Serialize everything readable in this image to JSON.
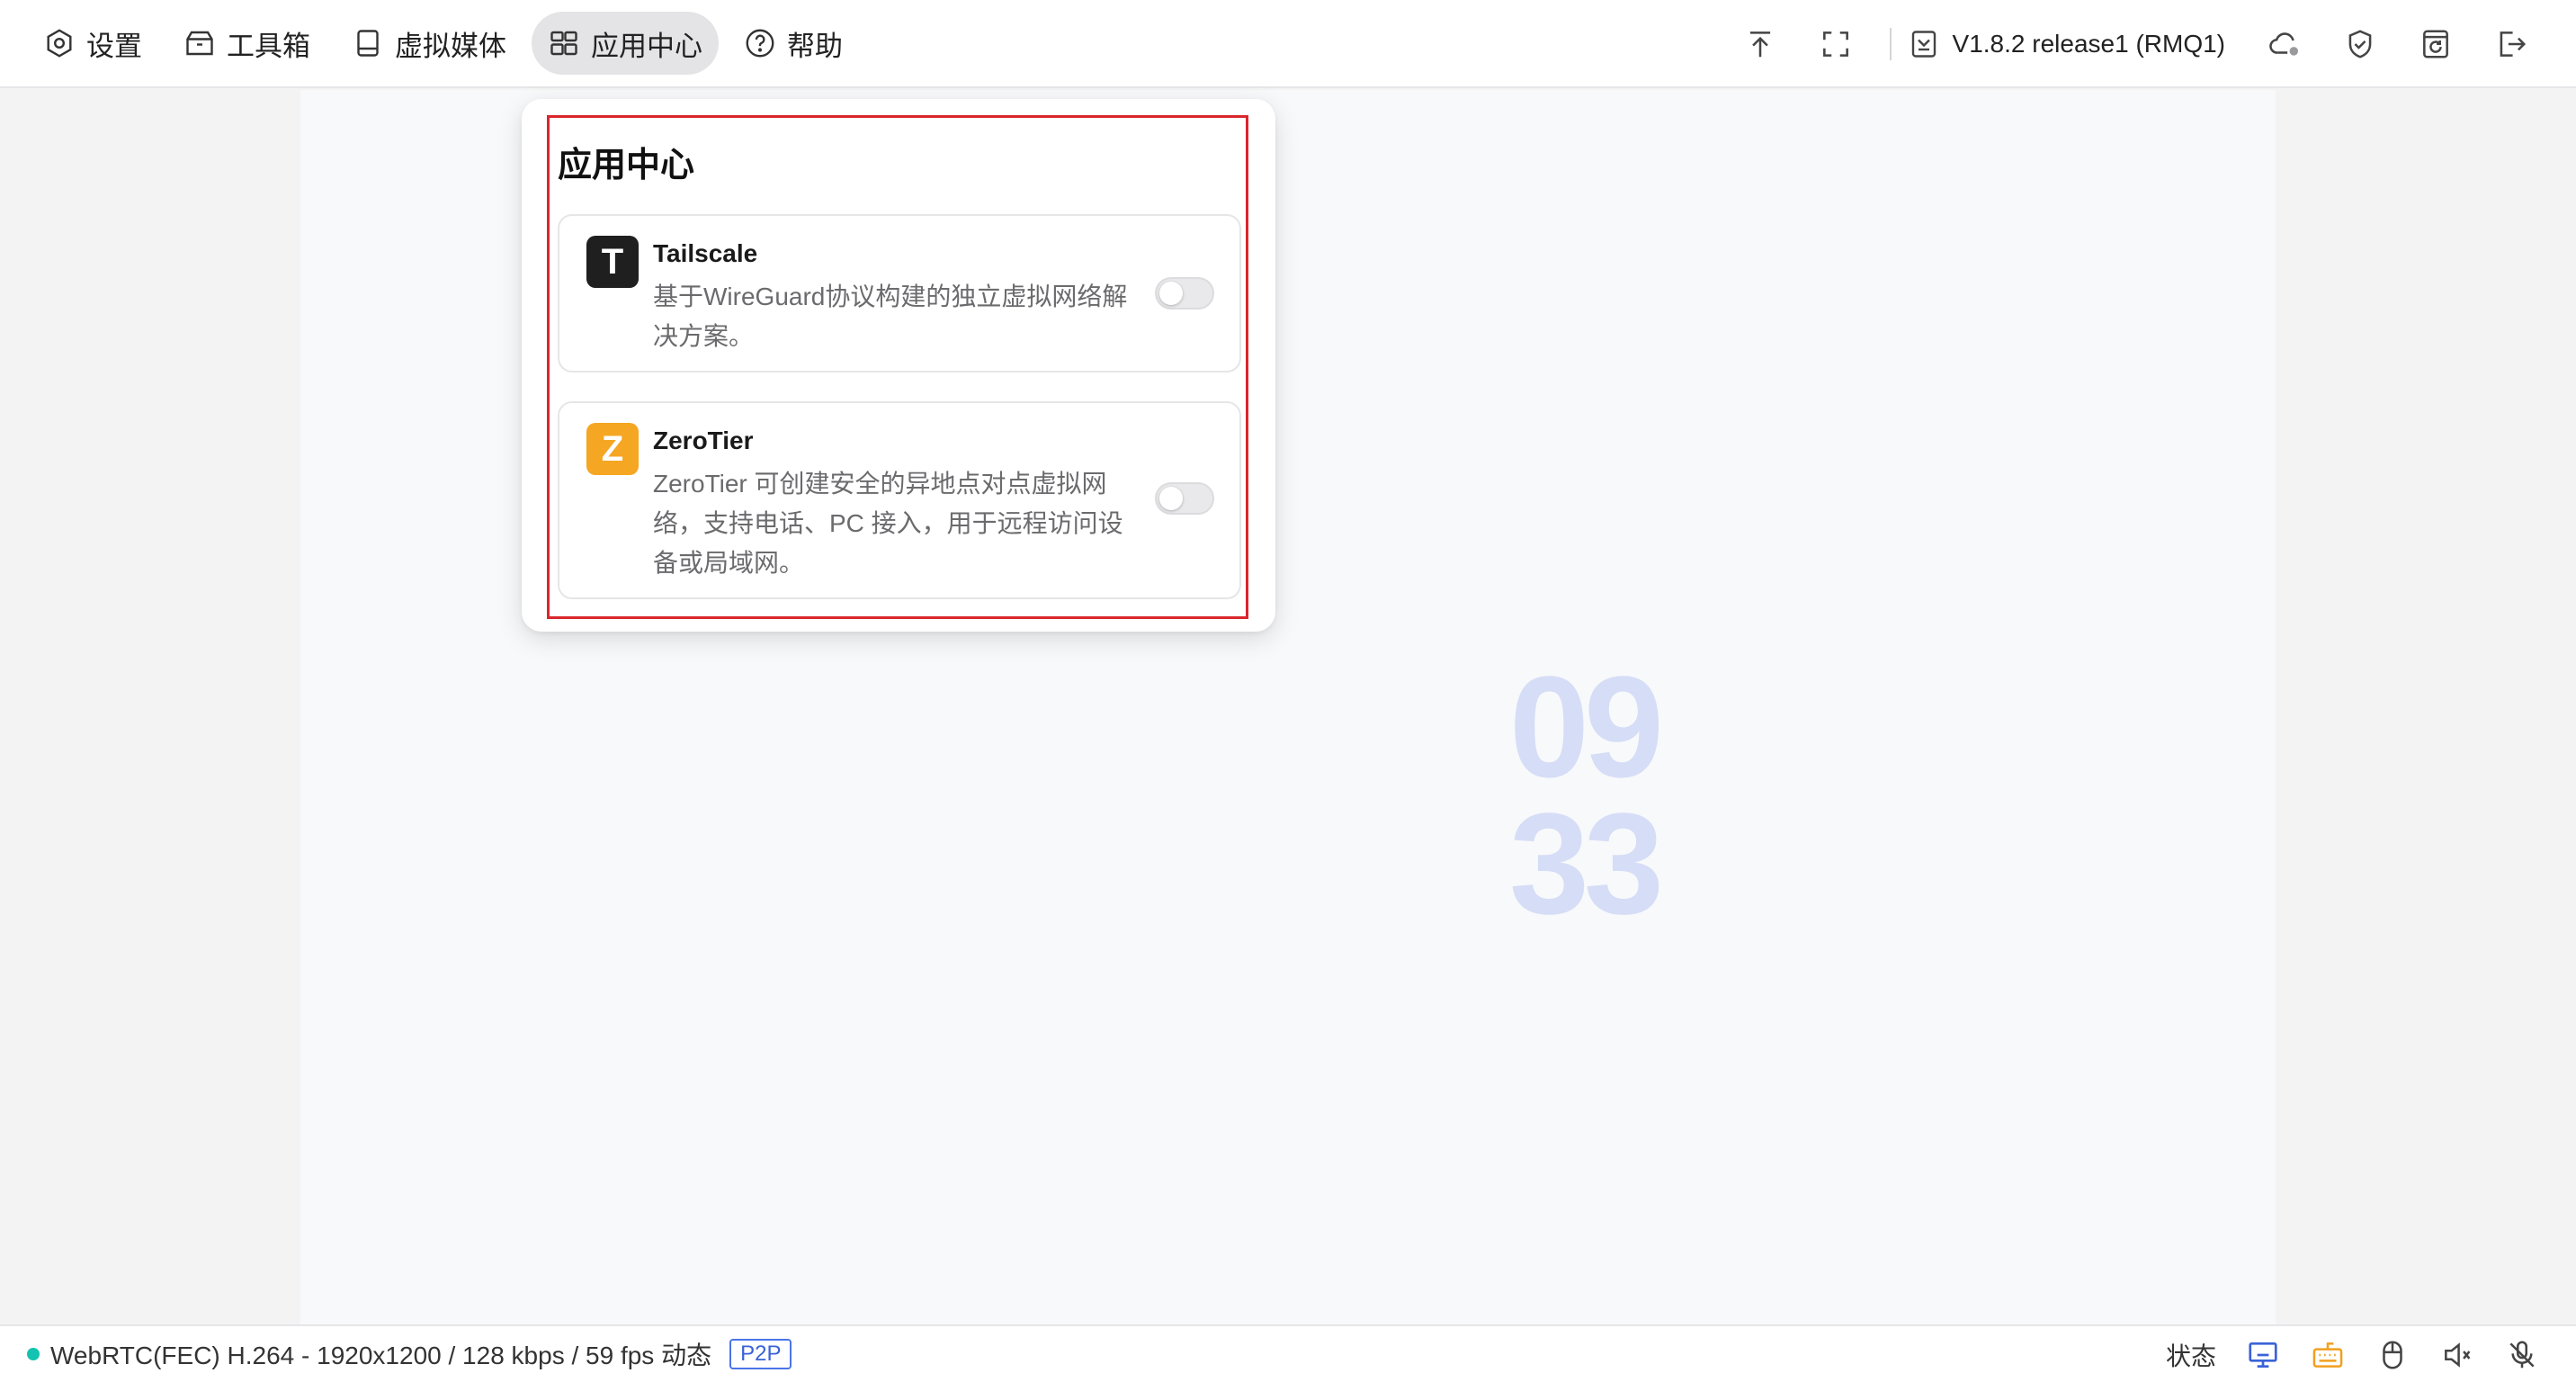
{
  "menu": {
    "items": [
      {
        "label": "设置",
        "icon": "settings-icon",
        "active": false
      },
      {
        "label": "工具箱",
        "icon": "toolbox-icon",
        "active": false
      },
      {
        "label": "虚拟媒体",
        "icon": "drive-icon",
        "active": false
      },
      {
        "label": "应用中心",
        "icon": "apps-icon",
        "active": true
      },
      {
        "label": "帮助",
        "icon": "help-icon",
        "active": false
      }
    ]
  },
  "toolbar": {
    "version": "V1.8.2 release1 (RMQ1)"
  },
  "screen": {
    "clock_hour": "09",
    "clock_minute": "33"
  },
  "app_center": {
    "title": "应用中心",
    "apps": [
      {
        "name": "Tailscale",
        "logo_letter": "T",
        "logo_color": "#1f1f1f",
        "description": "基于WireGuard协议构建的独立虚拟网络解决方案。",
        "enabled": false
      },
      {
        "name": "ZeroTier",
        "logo_letter": "Z",
        "logo_color": "#f5a623",
        "description": "ZeroTier 可创建安全的异地点对点虚拟网络，支持电话、PC 接入，用于远程访问设备或局域网。",
        "enabled": false
      }
    ]
  },
  "status": {
    "connection_dot_color": "#13c2b0",
    "stream_info": "WebRTC(FEC) H.264 - 1920x1200 /  128 kbps / 59 fps 动态",
    "mode_badge": "P2P",
    "status_label": "状态"
  },
  "colors": {
    "accent_blue": "#3a62d8",
    "keyboard_orange": "#f0a020",
    "highlight_red": "#d9262c"
  }
}
